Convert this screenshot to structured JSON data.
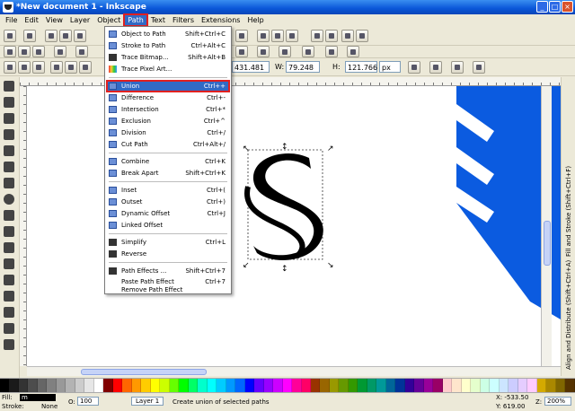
{
  "window": {
    "title": "*New document 1 - Inkscape",
    "minimize": "_",
    "maximize": "□",
    "close": "×"
  },
  "menubar": [
    {
      "key": "file",
      "label": "File"
    },
    {
      "key": "edit",
      "label": "Edit"
    },
    {
      "key": "view",
      "label": "View"
    },
    {
      "key": "layer",
      "label": "Layer"
    },
    {
      "key": "object",
      "label": "Object"
    },
    {
      "key": "path",
      "label": "Path"
    },
    {
      "key": "text",
      "label": "Text"
    },
    {
      "key": "filters",
      "label": "Filters"
    },
    {
      "key": "extensions",
      "label": "Extensions"
    },
    {
      "key": "help",
      "label": "Help"
    }
  ],
  "path_menu": {
    "items": [
      {
        "label": "Object to Path",
        "shortcut": "Shift+Ctrl+C",
        "icon": "object-to-path-icon"
      },
      {
        "label": "Stroke to Path",
        "shortcut": "Ctrl+Alt+C",
        "icon": "stroke-to-path-icon"
      },
      {
        "label": "Trace Bitmap...",
        "shortcut": "Shift+Alt+B",
        "icon": "trace-bitmap-icon"
      },
      {
        "label": "Trace Pixel Art...",
        "shortcut": "",
        "icon": "trace-pixel-art-icon"
      },
      {
        "label": "Union",
        "shortcut": "Ctrl++",
        "icon": "union-icon"
      },
      {
        "label": "Difference",
        "shortcut": "Ctrl+-",
        "icon": "difference-icon"
      },
      {
        "label": "Intersection",
        "shortcut": "Ctrl+*",
        "icon": "intersection-icon"
      },
      {
        "label": "Exclusion",
        "shortcut": "Ctrl+^",
        "icon": "exclusion-icon"
      },
      {
        "label": "Division",
        "shortcut": "Ctrl+/",
        "icon": "division-icon"
      },
      {
        "label": "Cut Path",
        "shortcut": "Ctrl+Alt+/",
        "icon": "cut-path-icon"
      },
      {
        "label": "Combine",
        "shortcut": "Ctrl+K",
        "icon": "combine-icon"
      },
      {
        "label": "Break Apart",
        "shortcut": "Shift+Ctrl+K",
        "icon": "break-apart-icon"
      },
      {
        "label": "Inset",
        "shortcut": "Ctrl+(",
        "icon": "inset-icon"
      },
      {
        "label": "Outset",
        "shortcut": "Ctrl+)",
        "icon": "outset-icon"
      },
      {
        "label": "Dynamic Offset",
        "shortcut": "Ctrl+J",
        "icon": "dynamic-offset-icon"
      },
      {
        "label": "Linked Offset",
        "shortcut": "",
        "icon": "linked-offset-icon"
      },
      {
        "label": "Simplify",
        "shortcut": "Ctrl+L",
        "icon": "simplify-icon"
      },
      {
        "label": "Reverse",
        "shortcut": "",
        "icon": "reverse-icon"
      },
      {
        "label": "Path Effects ...",
        "shortcut": "Shift+Ctrl+7",
        "icon": "path-effects-icon"
      },
      {
        "label": "Paste Path Effect",
        "shortcut": "Ctrl+7",
        "icon": ""
      },
      {
        "label": "Remove Path Effect",
        "shortcut": "",
        "icon": ""
      }
    ]
  },
  "toolcontrols": {
    "x_value": "431.481",
    "w_label": "W:",
    "w_value": "79.248",
    "h_label": "H:",
    "h_value": "121.766",
    "unit": "px"
  },
  "dock": {
    "fill_stroke": "Fill and Stroke (Shift+Ctrl+F)",
    "align": "Align and Distribute (Shift+Ctrl+A)"
  },
  "statusbar": {
    "fill_label": "Fill:",
    "fill_value": "m",
    "stroke_label": "Stroke:",
    "stroke_value": "None",
    "opacity_label": "O:",
    "opacity_value": "100",
    "layer": "Layer 1",
    "message": "Create union of selected paths",
    "x_coord": "X: -533.50",
    "y_coord": "Y: 619.00",
    "zoom_label": "Z:",
    "zoom_value": "200%"
  },
  "colors": {
    "accent_red": "#e02020",
    "highlight_blue": "#316ac5",
    "shape_blue": "#0b5be0"
  },
  "palette": [
    "#000000",
    "#1a1a1a",
    "#333333",
    "#4d4d4d",
    "#666666",
    "#808080",
    "#999999",
    "#b3b3b3",
    "#cccccc",
    "#e6e6e6",
    "#ffffff",
    "#800000",
    "#ff0000",
    "#ff6600",
    "#ff9900",
    "#ffcc00",
    "#ffff00",
    "#ccff00",
    "#66ff00",
    "#00ff00",
    "#00ff66",
    "#00ffcc",
    "#00ffff",
    "#00ccff",
    "#0099ff",
    "#0066ff",
    "#0000ff",
    "#6600ff",
    "#9900ff",
    "#cc00ff",
    "#ff00ff",
    "#ff0099",
    "#ff0066",
    "#993300",
    "#996600",
    "#999900",
    "#669900",
    "#339900",
    "#009933",
    "#009966",
    "#009999",
    "#006699",
    "#003399",
    "#330099",
    "#660099",
    "#990099",
    "#990066",
    "#ffcccc",
    "#ffe5cc",
    "#ffffcc",
    "#e5ffcc",
    "#ccffe5",
    "#ccffff",
    "#cce5ff",
    "#ccccff",
    "#e5ccff",
    "#ffccff",
    "#d4aa00",
    "#aa8800",
    "#806600",
    "#553300"
  ]
}
